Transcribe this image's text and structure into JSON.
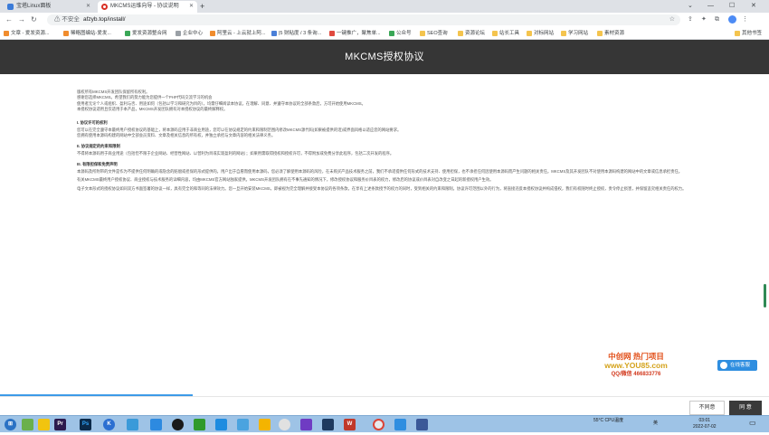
{
  "browser": {
    "tabs": [
      {
        "title": "宝塔Linux面板"
      },
      {
        "title": "MKCMS运维向导 - 协议说明"
      }
    ],
    "new_tab": "+",
    "security_label": "不安全",
    "url": "afzyb.top/install/",
    "other_bookmarks": "其他书签",
    "bookmarks": [
      "文章 - 爱发资源...",
      "稀略图编站-爱发...",
      "爱发资源整合网",
      "企业中心",
      "阿里云 - 上云就上阿...",
      "|5 财粘度 / 3 条询...",
      "一键推广，聚焦单...",
      "公众号",
      "SEO查询",
      "资源论坛",
      "站长工具",
      "对标网站",
      "学习网站",
      "素材资源"
    ]
  },
  "page": {
    "title": "MKCMS授权协议",
    "intro": [
      "版权所有MKCMS开发团队保留所有权利。",
      "感谢您选择MKCMS。希望我们的努力能为您提供一个PHP代码交流学习的机会",
      "使用者无论个人或组织、盈利与否、用途如何（包括以学习和研究为目的），均需仔细阅读本协议，在理解、同意、并遵守本协议的全部条款后，方可开始使用MKCMS。",
      "本授权协议适用且仅适用于本产品，MKCMS开发团队拥有对本授权协议的最终解释权。"
    ],
    "sections": [
      {
        "heading": "I. 协议许可的权利",
        "paragraphs": [
          "您可以在完全遵守本最终用户授权协议的基础上，将本源码应用于非商业用途，您可以在协议规定的约束和限制范围内修改MKCMS源代码(如果被提供的话)或界面风格以适应您的网站要求。",
          "您拥有使用本源码构建的网站中全部会员资料、文章及相关信息的所有权，并独立承担与文章内容的相关法律义务。"
        ]
      },
      {
        "heading": "II. 协议规定的约束和限制",
        "paragraphs": [
          "不得将本源码用于商业用途（包括但不限于企业网站、经营性网站、以营利为目或实现盈利的网站）；如果用需取得授权和授权许可，不得附加或免费分享此程序，包括二次开发的程序。"
        ]
      },
      {
        "heading": "III. 有限担保和免责声明",
        "paragraphs": [
          "本源码及所附带的文件是作为不提供任何明确的或隐含的赔偿或担保的形式提供的。用户出于自愿而使用本源码，您必须了解使用本源码的风险，在未购买产品技术服务之前，我们不承诺提供任何形式的技术支持、使用担保，也不承担任何因使用本源码而产生问题的相关责任。MKCMS及其开发团队不对使用本源码构建的网站中的文章或信息承担责任。",
          "有关MKCMS最终用户授权协议、商业授权与技术服务的详细内容，均由MKCMS官方网站独家提供。MKCMS开发团队拥有在不事先通知的情况下，修改授权协议和服务价目表的权力，修改后的协议或价目表对自改变之日起的新授权用户生效。",
          "电子文本形式的授权协议如同双方书面签署的协议一样，具有完全的和等同的法律效力。您一旦开始安装MKCMS，即被视为完全理解并接受本协议的各项条款，在享有上述条款授予的权力的同时，受到相关的约束和限制。协议许可范围以外的行为，将直接违反本授权协议并构成侵权，我们有权随时终止授权，责令停止损害，并保留追究相关责任的权力。"
        ]
      }
    ],
    "watermark": {
      "line1": "中创网 热门项目",
      "line2": "www.YOU85.com",
      "line3": "QQ/微信 466833776"
    },
    "float_button": "在线客服",
    "progress": 0.25,
    "decline_label": "不同意",
    "agree_label": "同 意"
  },
  "taskbar": {
    "weather": "55°C CPU温度",
    "ime": "英",
    "time": "03:01",
    "date": "2022-07-02"
  },
  "colors": {
    "hero_bg": "#363636",
    "agree_bg": "#3a3a3a",
    "progress": "#3c9be8",
    "taskbar": "#9ec3e6"
  }
}
